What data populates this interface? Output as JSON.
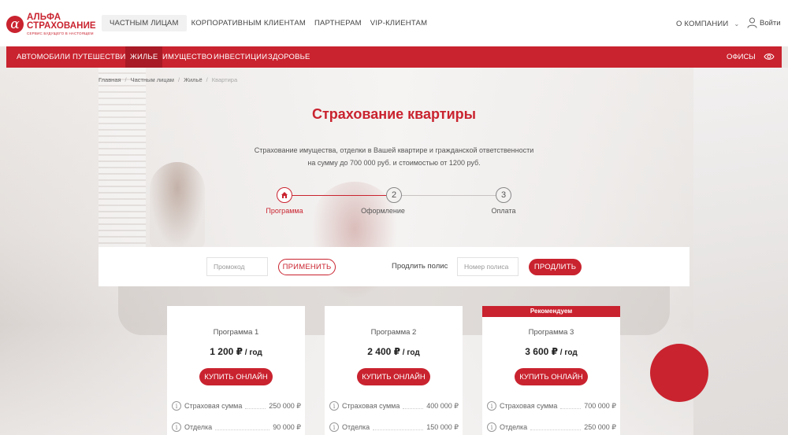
{
  "logo": {
    "line1": "АЛЬФА",
    "line2": "СТРАХОВАНИЕ",
    "tagline": "СЕРВИС БУДУЩЕГО В НАСТОЯЩЕМ",
    "mark": "α"
  },
  "topnav": {
    "items": [
      "ЧАСТНЫМ ЛИЦАМ",
      "КОРПОРАТИВНЫМ КЛИЕНТАМ",
      "ПАРТНЕРАМ",
      "VIP-КЛИЕНТАМ"
    ],
    "company": "О КОМПАНИИ",
    "login": "Войти"
  },
  "rednav": {
    "items": [
      "АВТОМОБИЛИ",
      "ПУТЕШЕСТВИЯ",
      "ЖИЛЬЕ",
      "ИМУЩЕСТВО",
      "ИНВЕСТИЦИИ",
      "ЗДОРОВЬЕ"
    ],
    "active": "ЖИЛЬЕ",
    "offices": "ОФИСЫ"
  },
  "breadcrumb": [
    "Главная",
    "Частным лицам",
    "Жильё",
    "Квартира"
  ],
  "page": {
    "title": "Страхование квартиры",
    "subtitle_line1": "Страхование имущества, отделки в Вашей квартире и гражданской ответственности",
    "subtitle_line2": "на сумму до 700 000 руб. и стоимостью от 1200 руб."
  },
  "stepper": {
    "steps": [
      {
        "number": "",
        "label": "Программа",
        "active": true
      },
      {
        "number": "2",
        "label": "Оформление",
        "active": false
      },
      {
        "number": "3",
        "label": "Оплата",
        "active": false
      }
    ]
  },
  "promo": {
    "promo_placeholder": "Промокод",
    "apply_label": "ПРИМЕНИТЬ",
    "renew_label": "Продлить полис",
    "policy_placeholder": "Номер полиса",
    "renew_button": "ПРОДЛИТЬ"
  },
  "cards": [
    {
      "badge": "",
      "name": "Программа 1",
      "price": "1 200 ₽",
      "period": " / год",
      "buy": "КУПИТЬ ОНЛАЙН",
      "rows": [
        {
          "label": "Страховая сумма",
          "value": "250 000 ₽"
        },
        {
          "label": "Отделка",
          "value": "90 000 ₽"
        }
      ]
    },
    {
      "badge": "",
      "name": "Программа 2",
      "price": "2 400 ₽",
      "period": " / год",
      "buy": "КУПИТЬ ОНЛАЙН",
      "rows": [
        {
          "label": "Страховая сумма",
          "value": "400 000 ₽"
        },
        {
          "label": "Отделка",
          "value": "150 000 ₽"
        }
      ]
    },
    {
      "badge": "Рекомендуем",
      "name": "Программа 3",
      "price": "3 600 ₽",
      "period": " / год",
      "buy": "КУПИТЬ ОНЛАЙН",
      "rows": [
        {
          "label": "Страховая сумма",
          "value": "700 000 ₽"
        },
        {
          "label": "Отделка",
          "value": "250 000 ₽"
        }
      ]
    }
  ],
  "icons": {
    "info": "i",
    "chevron": "⌄"
  },
  "colors": {
    "brand_red": "#c9232f",
    "active_nav": "#a81a25"
  }
}
